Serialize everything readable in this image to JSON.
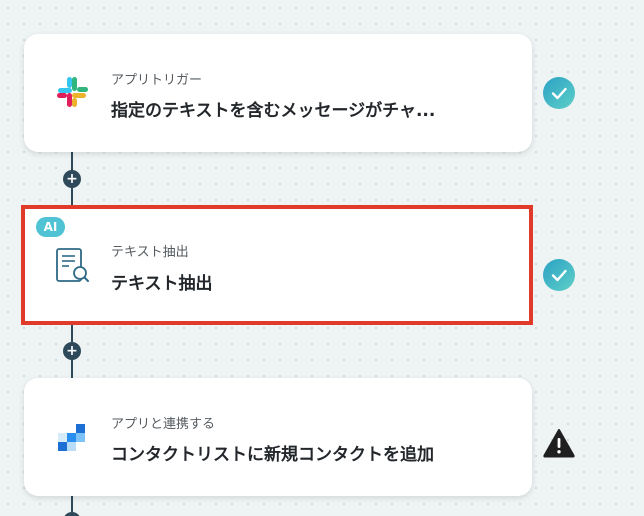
{
  "colors": {
    "accent_teal": "#4fc3d4",
    "connector": "#2e4a5a",
    "selected_border": "#e03a2b"
  },
  "connectors": {
    "add_step_icon": "plus-icon"
  },
  "steps": [
    {
      "subtitle": "アプリトリガー",
      "title": "指定のテキストを含むメッセージがチャ...",
      "icon": "slack-logo-icon",
      "status": "check-icon"
    },
    {
      "badge": "AI",
      "subtitle": "テキスト抽出",
      "title": "テキスト抽出",
      "icon": "document-search-icon",
      "status": "check-icon",
      "selected": true
    },
    {
      "subtitle": "アプリと連携する",
      "title": "コンタクトリストに新規コンタクトを追加",
      "icon": "blue-squares-app-icon",
      "status": "warning-icon"
    }
  ]
}
